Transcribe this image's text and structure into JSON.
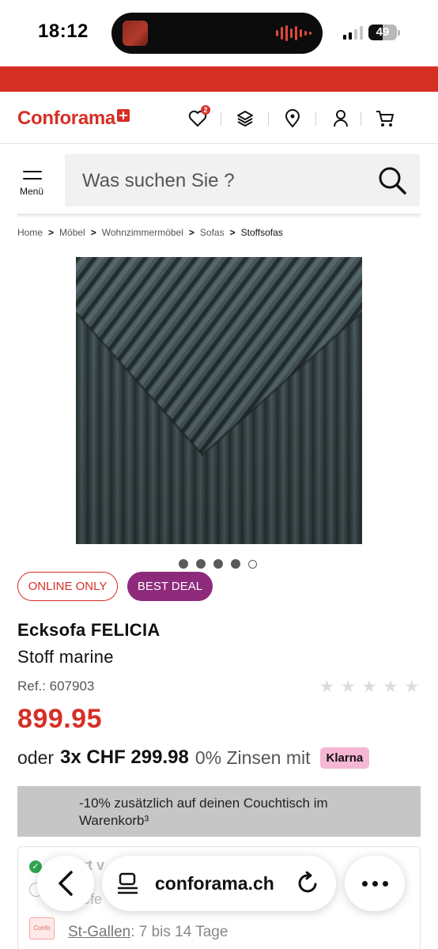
{
  "status_bar": {
    "time": "18:12",
    "battery": "49",
    "battery_level": 0.49
  },
  "header": {
    "logo": "Conforama",
    "wishlist_count": "2",
    "icons": [
      "heart-icon",
      "layers-icon",
      "location-pin-icon",
      "user-icon",
      "cart-icon"
    ]
  },
  "search": {
    "menu_label": "Menü",
    "placeholder": "Was suchen Sie ?"
  },
  "breadcrumb": [
    "Home",
    "Möbel",
    "Wohnzimmermöbel",
    "Sofas",
    "Stoffsofas"
  ],
  "gallery": {
    "image_count": 5,
    "active_index": 3
  },
  "tags": {
    "online": "ONLINE ONLY",
    "deal": "BEST DEAL"
  },
  "product": {
    "title": "Ecksofa FELICIA",
    "subtitle": "Stoff marine",
    "ref": "Ref.: 607903",
    "rating": 0,
    "rating_max": 5,
    "price": "899.95",
    "installment_prefix": "oder",
    "installment_amount": "3x CHF 299.98",
    "installment_suffix": "0% Zinsen mit",
    "klarna": "Klarna"
  },
  "promo": {
    "text": "-10% zusätzlich auf deinen Couchtisch im Warenkorb³"
  },
  "delivery": {
    "line1": "rt v",
    "line2": "efe",
    "store_name": "St-Gallen",
    "store_time": ": 7 bis 14 Tage",
    "store_icon_label": "Confo"
  },
  "browser": {
    "url": "conforama.ch"
  },
  "colors": {
    "brand_red": "#d62f26",
    "deal_purple": "#8e2a7c",
    "klarna_pink": "#f5b7d3"
  }
}
